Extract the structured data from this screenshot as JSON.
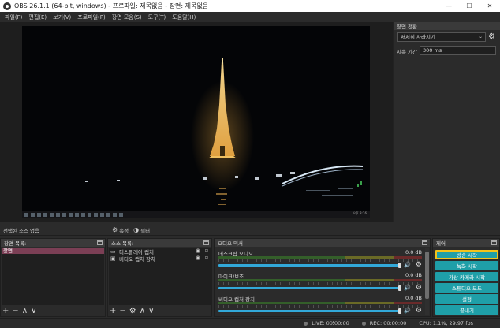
{
  "window": {
    "title": "OBS 26.1.1 (64-bit, windows) - 프로파일: 제목없음 - 장면: 제목없음",
    "minimize": "—",
    "maximize": "☐",
    "close": "✕"
  },
  "menu": [
    "파일(F)",
    "편집(E)",
    "보기(V)",
    "프로파일(P)",
    "장면 모음(S)",
    "도구(T)",
    "도움말(H)"
  ],
  "preview": {
    "taskbar_clock": "오후 8:16"
  },
  "transitions": {
    "title": "장면 전환",
    "selected": "서서히 사라지기",
    "duration_label": "지속 기간",
    "duration_value": "300 ms"
  },
  "context_bar": {
    "no_source": "선택된 소스 없음",
    "properties": "속성",
    "filters": "필터"
  },
  "scenes": {
    "title": "장면 목록:",
    "items": [
      "장면"
    ]
  },
  "sources": {
    "title": "소스 목록:",
    "items": [
      {
        "label": "디스플레이 캡처",
        "icon": "monitor-icon"
      },
      {
        "label": "비디오 캡처 장치",
        "icon": "camera-icon"
      }
    ]
  },
  "mixer": {
    "title": "오디오 믹서",
    "channels": [
      {
        "name": "데스크탑 오디오",
        "db": "0.0 dB",
        "volume": 1.0
      },
      {
        "name": "마이크/보조",
        "db": "0.0 dB",
        "volume": 1.0
      },
      {
        "name": "비디오 캡처 장치",
        "db": "0.0 dB",
        "volume": 1.0
      }
    ]
  },
  "controls": {
    "title": "제어",
    "buttons": [
      "방송 시작",
      "녹화 시작",
      "가상 카메라 시작",
      "스튜디오 모드",
      "설정",
      "끝내기"
    ],
    "focused_index": 0
  },
  "status": {
    "live": "LIVE: 00:00:00",
    "rec": "REC: 00:00:00",
    "cpu": "CPU: 1.1%, 29.97 fps"
  },
  "colors": {
    "accent_button": "#1f9fa8",
    "focus_outline": "#f2c21b",
    "scene_selected": "#7b3f55",
    "fader": "#32a8d8"
  }
}
